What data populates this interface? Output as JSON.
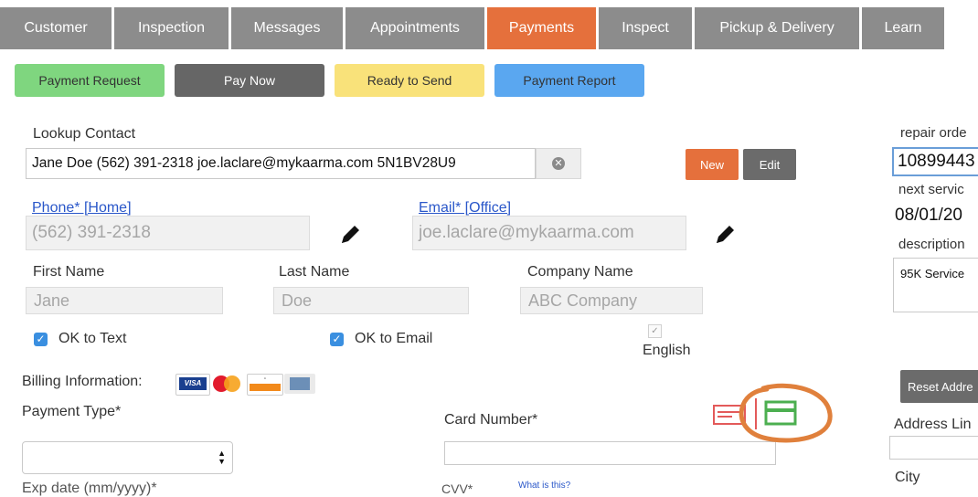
{
  "tabs": [
    "Customer",
    "Inspection",
    "Messages",
    "Appointments",
    "Payments",
    "Inspect",
    "Pickup & Delivery",
    "Learn"
  ],
  "active_tab": "Payments",
  "actions": {
    "payment_request": "Payment Request",
    "pay_now": "Pay Now",
    "ready_to_send": "Ready to Send",
    "payment_report": "Payment Report"
  },
  "lookup": {
    "label": "Lookup Contact",
    "value": "Jane Doe (562) 391-2318 joe.laclare@mykaarma.com 5N1BV28U9",
    "new_label": "New",
    "edit_label": "Edit"
  },
  "contact": {
    "phone_label": "Phone* [Home]",
    "phone_value": "(562) 391-2318",
    "email_label": "Email* [Office]",
    "email_value": "joe.laclare@mykaarma.com",
    "first_name_label": "First Name",
    "first_name_value": "Jane",
    "last_name_label": "Last Name",
    "last_name_value": "Doe",
    "company_label": "Company Name",
    "company_value": "ABC Company",
    "ok_text_label": "OK to Text",
    "ok_email_label": "OK to Email",
    "language_label": "English"
  },
  "billing": {
    "label": "Billing Information:",
    "payment_type_label": "Payment Type*",
    "card_number_label": "Card Number*",
    "exp_label": "Exp date (mm/yyyy)*",
    "cvv_label": "CVV*",
    "what_is_this": "What is this?"
  },
  "right_panel": {
    "repair_order_label": "repair orde",
    "repair_order_value": "10899443",
    "next_service_label": "next servic",
    "next_service_value": "08/01/20",
    "description_label": "description",
    "description_value": "95K Service",
    "reset_button": "Reset Addre",
    "address_label": "Address Lin",
    "city_label": "City"
  },
  "colors": {
    "tab_bg": "#8c8c8c",
    "tab_active": "#e5703c",
    "payment_request": "#7fd67f",
    "pay_now": "#666666",
    "ready_to_send": "#f9e27a",
    "payment_report": "#5aa7f0",
    "new_btn": "#e5703c",
    "edit_btn": "#6b6b6b",
    "checkbox": "#3a8fe0",
    "annotation": "#e0803c"
  },
  "icons": [
    "clear-icon",
    "pencil-icon",
    "visa-icon",
    "mastercard-icon",
    "discover-icon",
    "amex-icon",
    "card-swipe-icon",
    "card-manual-icon",
    "select-arrows-icon",
    "checkmark-icon"
  ]
}
